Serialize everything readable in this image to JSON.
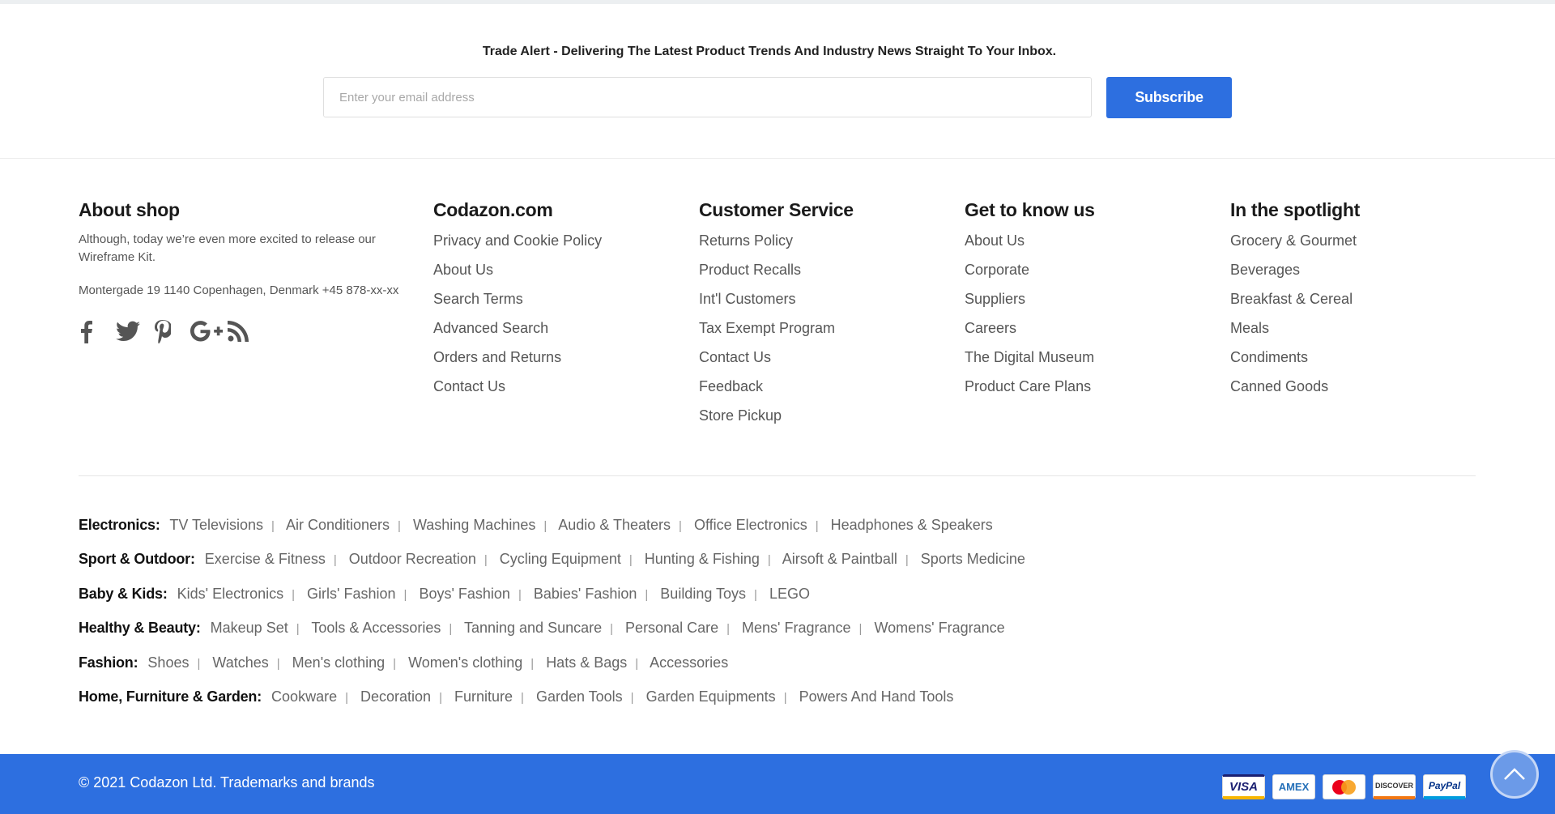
{
  "newsletter": {
    "text": "Trade Alert - Delivering The Latest Product Trends And Industry News Straight To Your Inbox.",
    "placeholder": "Enter your email address",
    "button": "Subscribe"
  },
  "about": {
    "title": "About shop",
    "description": "Although, today we’re even more excited to release our Wireframe Kit.",
    "address": "Montergade 19 1140 Copenhagen, Denmark +45 878-xx-xx",
    "social": [
      "facebook-icon",
      "twitter-icon",
      "pinterest-icon",
      "google-plus-icon",
      "rss-icon"
    ]
  },
  "columns": [
    {
      "title": "Codazon.com",
      "links": [
        "Privacy and Cookie Policy",
        "About Us",
        "Search Terms",
        "Advanced Search",
        "Orders and Returns",
        "Contact Us"
      ]
    },
    {
      "title": "Customer Service",
      "links": [
        "Returns Policy",
        "Product Recalls",
        "Int'l Customers",
        "Tax Exempt Program",
        "Contact Us",
        "Feedback",
        "Store Pickup"
      ]
    },
    {
      "title": "Get to know us",
      "links": [
        "About Us",
        "Corporate",
        "Suppliers",
        "Careers",
        "The Digital Museum",
        "Product Care Plans"
      ]
    },
    {
      "title": "In the spotlight",
      "links": [
        "Grocery & Gourmet",
        "Beverages",
        "Breakfast & Cereal",
        "Meals",
        "Condiments",
        "Canned Goods"
      ]
    }
  ],
  "categories": [
    {
      "title": "Electronics:",
      "items": [
        "TV Televisions",
        "Air Conditioners",
        "Washing Machines",
        "Audio & Theaters",
        "Office Electronics",
        "Headphones & Speakers"
      ]
    },
    {
      "title": "Sport & Outdoor:",
      "items": [
        "Exercise & Fitness",
        "Outdoor Recreation",
        "Cycling Equipment",
        "Hunting & Fishing",
        "Airsoft & Paintball",
        "Sports Medicine"
      ]
    },
    {
      "title": "Baby & Kids:",
      "items": [
        "Kids' Electronics",
        "Girls' Fashion",
        "Boys' Fashion",
        "Babies' Fashion",
        "Building Toys",
        "LEGO"
      ]
    },
    {
      "title": "Healthy & Beauty:",
      "items": [
        "Makeup Set",
        "Tools & Accessories",
        "Tanning and Suncare",
        "Personal Care",
        "Mens' Fragrance",
        "Womens' Fragrance"
      ]
    },
    {
      "title": "Fashion:",
      "items": [
        "Shoes",
        "Watches",
        "Men's clothing",
        "Women's clothing",
        "Hats & Bags",
        "Accessories"
      ]
    },
    {
      "title": "Home, Furniture & Garden:",
      "items": [
        "Cookware",
        "Decoration",
        "Furniture",
        "Garden Tools",
        "Garden Equipments",
        "Powers And Hand Tools"
      ]
    }
  ],
  "footer": {
    "copyright": "© 2021 Codazon Ltd. Trademarks and brands",
    "payments": [
      {
        "name": "visa-icon",
        "label": "VISA"
      },
      {
        "name": "amex-icon",
        "label": "AMEX"
      },
      {
        "name": "mastercard-icon",
        "label": ""
      },
      {
        "name": "discover-icon",
        "label": "DISCOVER"
      },
      {
        "name": "paypal-icon",
        "label": "PayPal"
      }
    ]
  },
  "colors": {
    "accent": "#2d6fe0"
  }
}
